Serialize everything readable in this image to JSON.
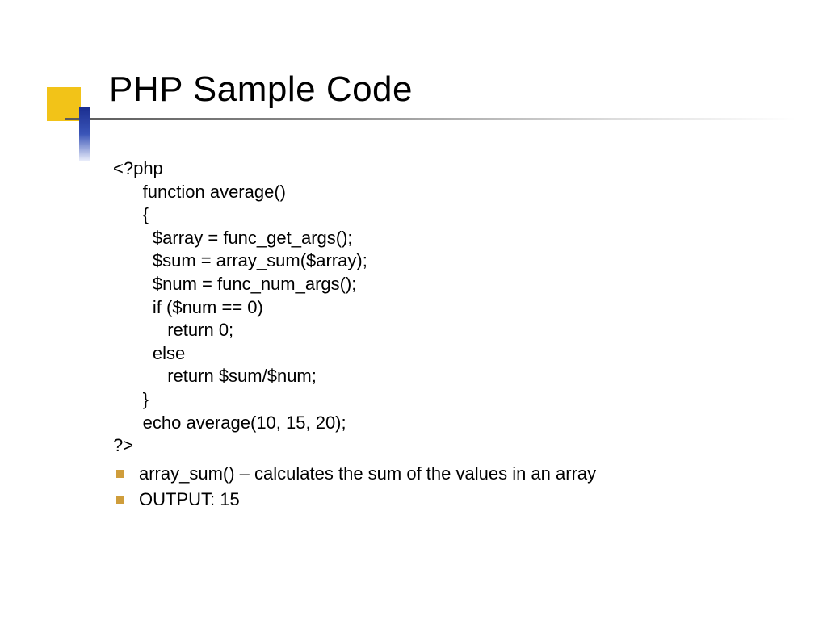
{
  "title": "PHP Sample Code",
  "code": "<?php\n      function average()\n      {\n        $array = func_get_args();\n        $sum = array_sum($array);\n        $num = func_num_args();\n        if ($num == 0)\n           return 0;\n        else\n           return $sum/$num;\n      }\n      echo average(10, 15, 20);\n?>",
  "bullets": [
    "array_sum() – calculates the sum of the values in an array",
    "OUTPUT: 15"
  ]
}
